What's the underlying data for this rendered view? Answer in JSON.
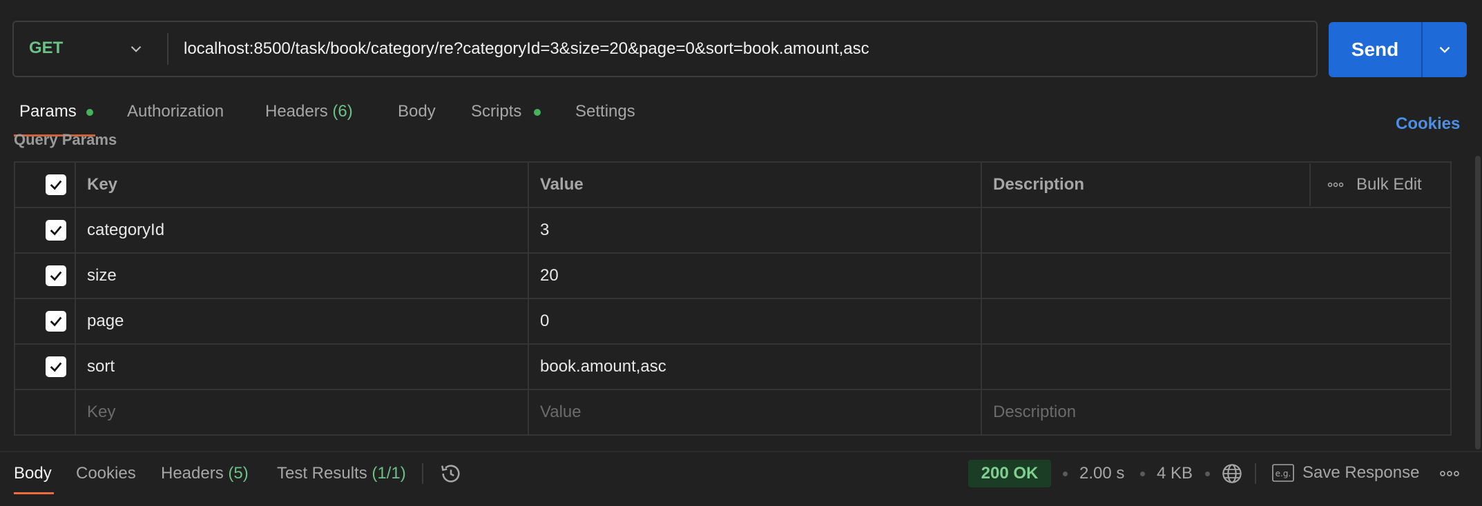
{
  "request": {
    "method": "GET",
    "url": "localhost:8500/task/book/category/re?categoryId=3&size=20&page=0&sort=book.amount,asc",
    "send_label": "Send"
  },
  "tabs": [
    {
      "label": "Params",
      "active": true,
      "dot": true
    },
    {
      "label": "Authorization"
    },
    {
      "label": "Headers",
      "count": "(6)"
    },
    {
      "label": "Body"
    },
    {
      "label": "Scripts",
      "dot": true
    },
    {
      "label": "Settings"
    }
  ],
  "cookies_label": "Cookies",
  "section_title": "Query Params",
  "params_table": {
    "headers": {
      "key": "Key",
      "value": "Value",
      "description": "Description",
      "bulk_edit": "Bulk Edit"
    },
    "rows": [
      {
        "key": "categoryId",
        "value": "3",
        "description": "",
        "checked": true
      },
      {
        "key": "size",
        "value": "20",
        "description": "",
        "checked": true
      },
      {
        "key": "page",
        "value": "0",
        "description": "",
        "checked": true
      },
      {
        "key": "sort",
        "value": "book.amount,asc",
        "description": "",
        "checked": true
      }
    ],
    "placeholders": {
      "key": "Key",
      "value": "Value",
      "description": "Description"
    }
  },
  "response": {
    "tabs": [
      {
        "label": "Body",
        "active": true
      },
      {
        "label": "Cookies"
      },
      {
        "label": "Headers",
        "count": "(5)"
      },
      {
        "label": "Test Results",
        "count": "(1/1)"
      }
    ],
    "status": "200 OK",
    "time": "2.00 s",
    "size": "4 KB",
    "save_label": "Save Response"
  },
  "colors": {
    "background": "#212121",
    "accent_blue": "#1f6ad9",
    "method_green": "#6cc187",
    "active_underline": "#ee6d3d",
    "status_green": "#7fd08f"
  },
  "icons": [
    "chevron-down-icon",
    "history-icon",
    "globe-icon",
    "example-icon",
    "more-icon",
    "checkbox-checked-icon"
  ]
}
